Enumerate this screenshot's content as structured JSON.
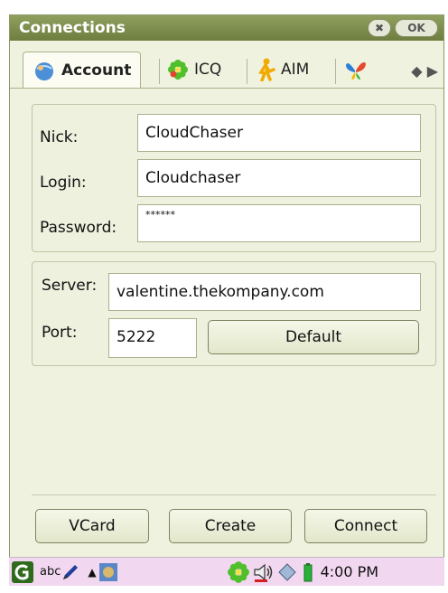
{
  "window": {
    "title": "Connections"
  },
  "title_buttons": {
    "close": "✖",
    "ok": "OK"
  },
  "tabs": [
    {
      "label": "Account",
      "icon": "globe-user-icon",
      "active": true
    },
    {
      "label": "ICQ",
      "icon": "icq-flower-icon",
      "active": false
    },
    {
      "label": "AIM",
      "icon": "aim-running-man-icon",
      "active": false
    },
    {
      "label": "",
      "icon": "msn-butterfly-icon",
      "active": false
    }
  ],
  "tab_scroll": {
    "left": "◆",
    "right": "▶"
  },
  "account": {
    "nick_label": "Nick:",
    "nick_value": "CloudChaser",
    "login_label": "Login:",
    "login_value": "Cloudchaser",
    "password_label": "Password:",
    "password_value": "******"
  },
  "server": {
    "server_label": "Server:",
    "server_value": "valentine.thekompany.com",
    "port_label": "Port:",
    "port_value": "5222",
    "default_button": "Default"
  },
  "footer_buttons": {
    "vcard": "VCard",
    "create": "Create",
    "connect": "Connect"
  },
  "taskbar": {
    "input_mode": "abc",
    "time": "4:00 PM"
  },
  "colors": {
    "title_bar": "#7b8b4b",
    "panel_bg": "#edf1de",
    "taskbar_bg": "#f1d7ef"
  }
}
